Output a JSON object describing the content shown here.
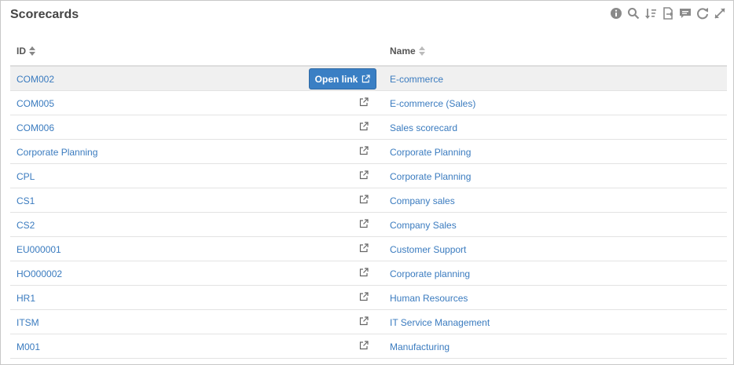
{
  "panel": {
    "title": "Scorecards",
    "toolbar": [
      {
        "icon": "info-icon"
      },
      {
        "icon": "search-icon"
      },
      {
        "icon": "sort-icon"
      },
      {
        "icon": "export-icon"
      },
      {
        "icon": "comment-icon"
      },
      {
        "icon": "refresh-icon"
      },
      {
        "icon": "expand-icon"
      }
    ]
  },
  "table": {
    "columns": {
      "id": "ID",
      "name": "Name"
    },
    "open_link_label": "Open link",
    "rows": [
      {
        "id": "COM002",
        "name": "E-commerce"
      },
      {
        "id": "COM005",
        "name": "E-commerce (Sales)"
      },
      {
        "id": "COM006",
        "name": "Sales scorecard"
      },
      {
        "id": "Corporate Planning",
        "name": "Corporate Planning"
      },
      {
        "id": "CPL",
        "name": "Corporate Planning"
      },
      {
        "id": "CS1",
        "name": "Company sales"
      },
      {
        "id": "CS2",
        "name": "Company Sales"
      },
      {
        "id": "EU000001",
        "name": "Customer Support"
      },
      {
        "id": "HO000002",
        "name": "Corporate planning"
      },
      {
        "id": "HR1",
        "name": "Human Resources"
      },
      {
        "id": "ITSM",
        "name": "IT Service Management"
      },
      {
        "id": "M001",
        "name": "Manufacturing"
      }
    ]
  },
  "colors": {
    "link": "#3a7bbf",
    "button": "#3a7fc4",
    "hover_row": "#f0f0f0"
  }
}
